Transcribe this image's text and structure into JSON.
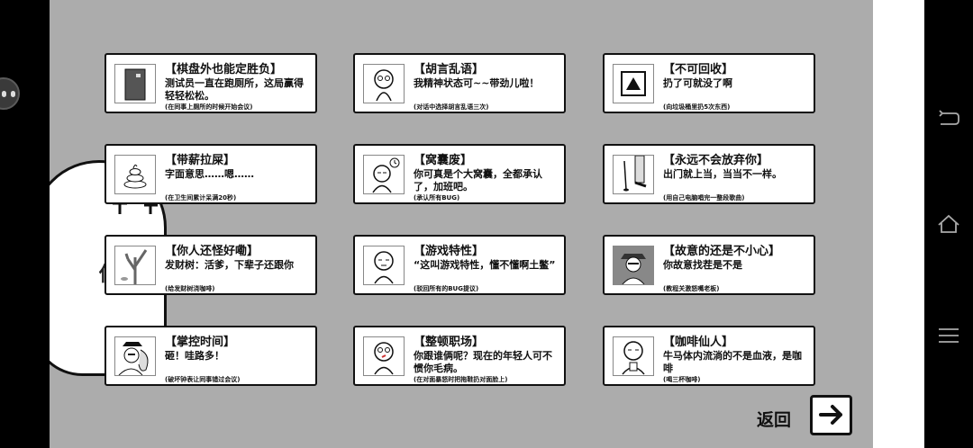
{
  "ghost_text": "你",
  "achievements": [
    {
      "title": "【棋盘外也能定胜负】",
      "desc": "测试员一直在跑厕所，这局赢得轻轻松松。",
      "note": "(在同事上厕所的时候开始会议)",
      "icon": "door-icon"
    },
    {
      "title": "【胡言乱语】",
      "desc": "我精神状态可~~带劲儿啦！",
      "note": "(对话中选择胡言乱语三次)",
      "icon": "dizzy-face-icon"
    },
    {
      "title": "【不可回收】",
      "desc": "扔了可就没了啊",
      "note": "(向垃圾桶里扔5次东西)",
      "icon": "recycle-icon"
    },
    {
      "title": "【带薪拉屎】",
      "desc": "字面意思……嗯……",
      "note": "(在卫生间累计呆满20秒)",
      "icon": "poop-icon"
    },
    {
      "title": "【窝囊废】",
      "desc": "你可真是个大窝囊，全都承认了，加班吧。",
      "note": "(承认所有BUG)",
      "icon": "sad-worker-icon"
    },
    {
      "title": "【永远不会放弃你】",
      "desc": "出门就上当，当当不一样。",
      "note": "(用自己电脑唱完一整段歌曲)",
      "icon": "dancing-legs-icon"
    },
    {
      "title": "【你人还怪好嘞】",
      "desc": "发财树：活爹，下辈子还跟你",
      "note": "(给发财树浇咖啡)",
      "icon": "dead-tree-icon"
    },
    {
      "title": "【游戏特性】",
      "desc": "“这叫游戏特性，懂不懂啊土鳖”",
      "note": "(驳回所有的BUG提议)",
      "icon": "smug-face-icon"
    },
    {
      "title": "【故意的还是不小心】",
      "desc": "你故意找茬是不是",
      "note": "(教程关激怒嘴老板)",
      "icon": "hat-boss-icon"
    },
    {
      "title": "【掌控时间】",
      "desc": "砸！哇路多！",
      "note": "(破坏钟表让同事错过会议)",
      "icon": "time-stop-icon"
    },
    {
      "title": "【整顿职场】",
      "desc": "你跟谁俩呢？现在的年轻人可不惯你毛病。",
      "note": "(在对面暴怒时把拖鞋扔对面脸上)",
      "icon": "angry-face-icon"
    },
    {
      "title": "【咖啡仙人】",
      "desc": "牛马体内流淌的不是血液，是咖啡",
      "note": "(喝三杯咖啡)",
      "icon": "coffee-man-icon"
    }
  ],
  "back_label": "返回",
  "colors": {
    "stage": "#acacac",
    "card": "#ffffff",
    "border": "#111111"
  }
}
